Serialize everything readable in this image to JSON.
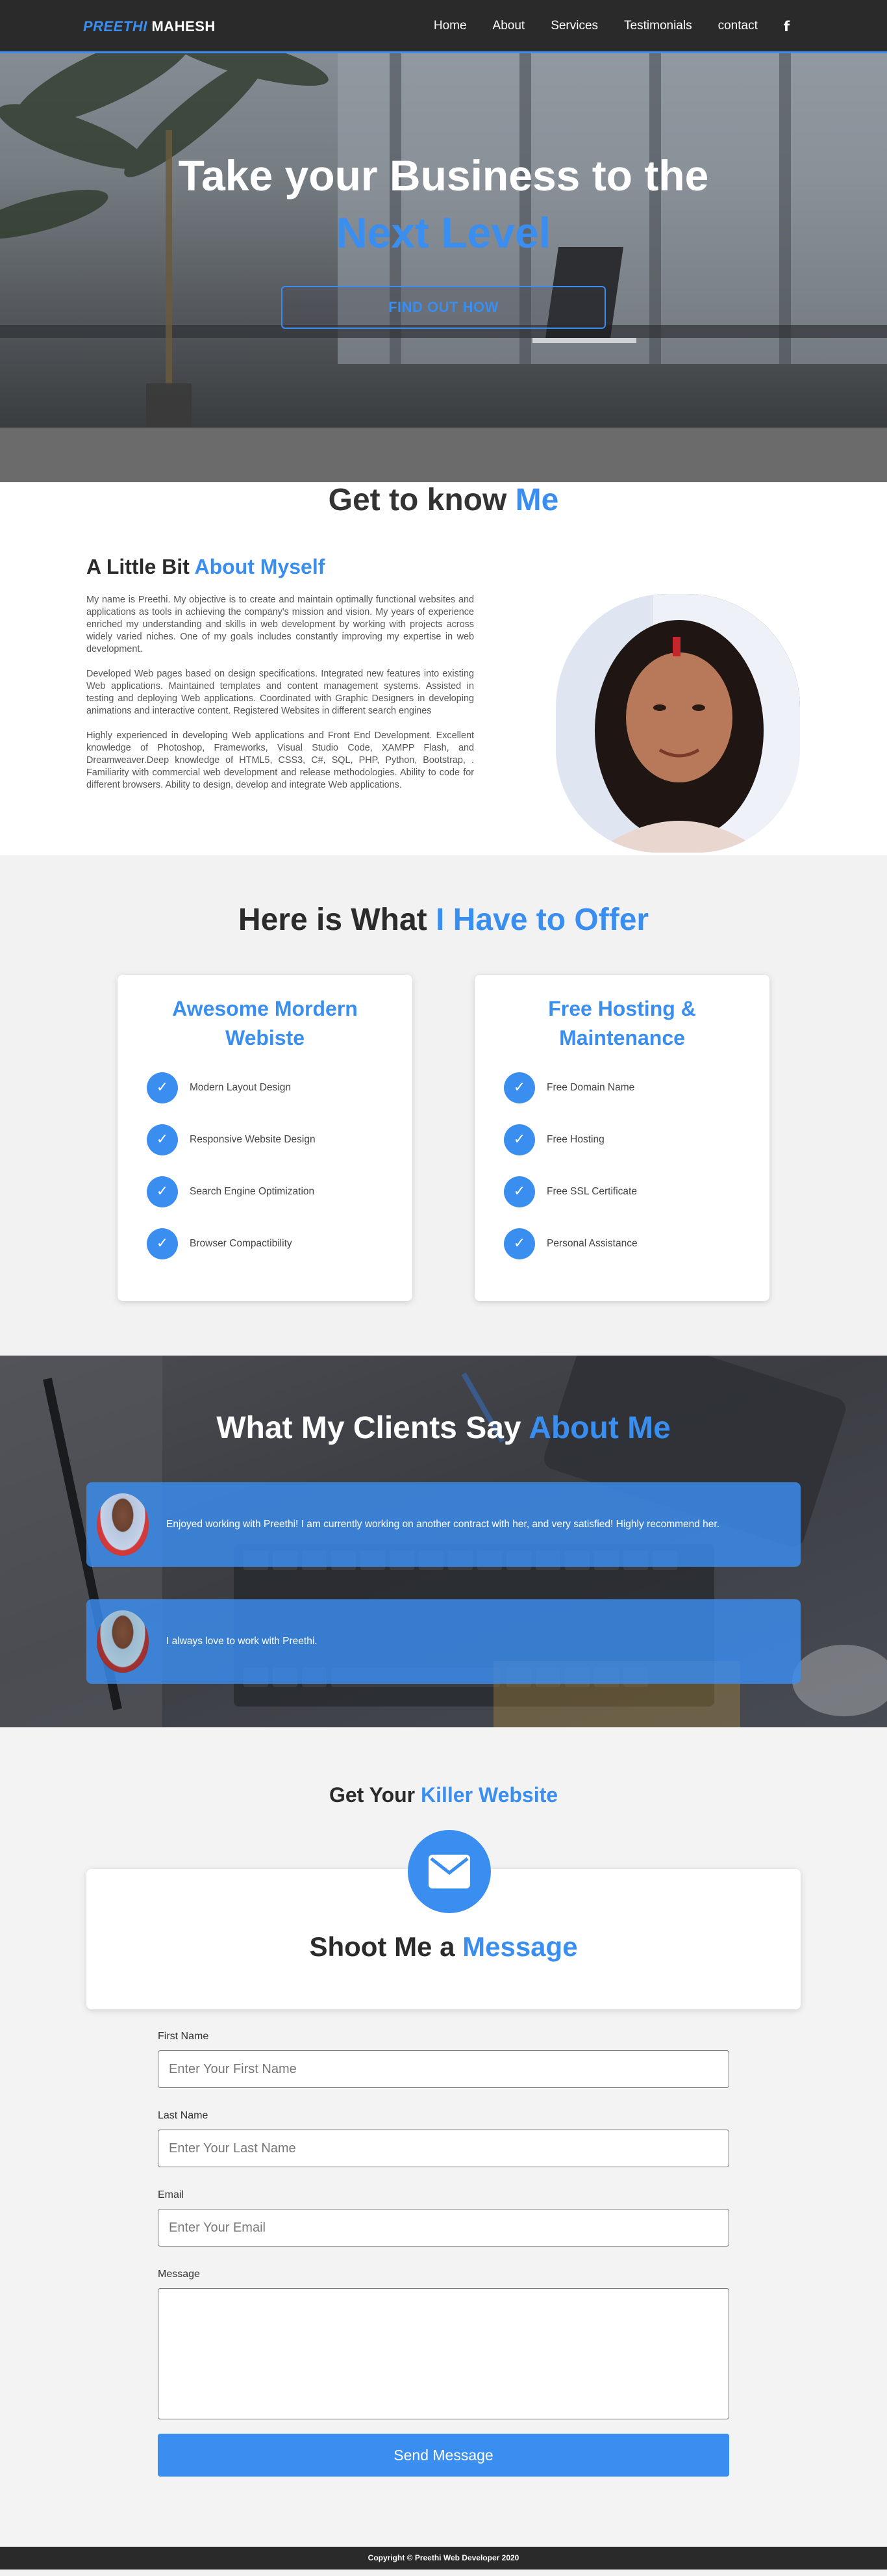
{
  "nav": {
    "brand_first": "PREETHI",
    "brand_last": "MAHESH",
    "items": [
      {
        "label": "Home"
      },
      {
        "label": "About"
      },
      {
        "label": "Services"
      },
      {
        "label": "Testimonials"
      },
      {
        "label": "contact"
      }
    ],
    "facebook_glyph": "f"
  },
  "hero": {
    "title_line1": "Take your Business to the",
    "title_line2": "Next Level",
    "cta": "FIND OUT HOW"
  },
  "about": {
    "heading_plain": "Get to know",
    "heading_accent": "Me",
    "subheading_plain": "A Little Bit",
    "subheading_accent": "About Myself",
    "paragraphs": [
      "My name is Preethi. My objective is to create and maintain optimally functional websites and applications as tools in achieving the company's mission and vision. My years of experience enriched my understanding and skills in web development by working with projects across widely varied niches. One of my goals includes constantly improving my expertise in web development.",
      "Developed Web pages based on design specifications. Integrated new features into existing Web applications. Maintained templates and content management systems. Assisted in testing and deploying Web applications. Coordinated with Graphic Designers in developing animations and interactive content. Registered Websites in different search engines",
      "Highly experienced in developing Web applications and Front End Development. Excellent knowledge of Photoshop, Frameworks, Visual Studio Code, XAMPP Flash, and Dreamweaver.Deep knowledge of HTML5, CSS3, C#, SQL, PHP, Python, Bootstrap, . Familiarity with commercial web development and release methodologies. Ability to code for different browsers. Ability to design, develop and integrate Web applications."
    ]
  },
  "offer": {
    "heading_plain": "Here is What",
    "heading_accent": "I Have to Offer",
    "cards": [
      {
        "title": "Awesome Mordern Webiste",
        "features": [
          "Modern Layout Design",
          "Responsive Website Design",
          "Search Engine Optimization",
          "Browser Compactibility"
        ]
      },
      {
        "title": "Free Hosting & Maintenance",
        "features": [
          "Free Domain Name",
          "Free Hosting",
          "Free SSL Certificate",
          "Personal Assistance"
        ]
      }
    ],
    "check_glyph": "✓"
  },
  "clients": {
    "heading_plain": "What My Clients Say",
    "heading_accent": "About Me",
    "testimonials": [
      {
        "quote": "Enjoyed working with Preethi! I am currently working on another contract with her, and very satisfied! Highly recommend her."
      },
      {
        "quote": "I always love to work with Preethi."
      }
    ]
  },
  "contact": {
    "kicker_plain": "Get Your",
    "kicker_accent": "Killer Website",
    "heading_plain": "Shoot Me a",
    "heading_accent": "Message",
    "first_name_label": "First Name",
    "first_name_placeholder": "Enter Your First Name",
    "last_name_label": "Last Name",
    "last_name_placeholder": "Enter Your Last Name",
    "email_label": "Email",
    "email_placeholder": "Enter Your Email",
    "message_label": "Message",
    "send_label": "Send Message"
  },
  "footer": {
    "text": "Copyright © Preethi Web Developer 2020"
  },
  "colors": {
    "accent": "#3a8ef0",
    "nav_bg": "#2a2a2a"
  }
}
